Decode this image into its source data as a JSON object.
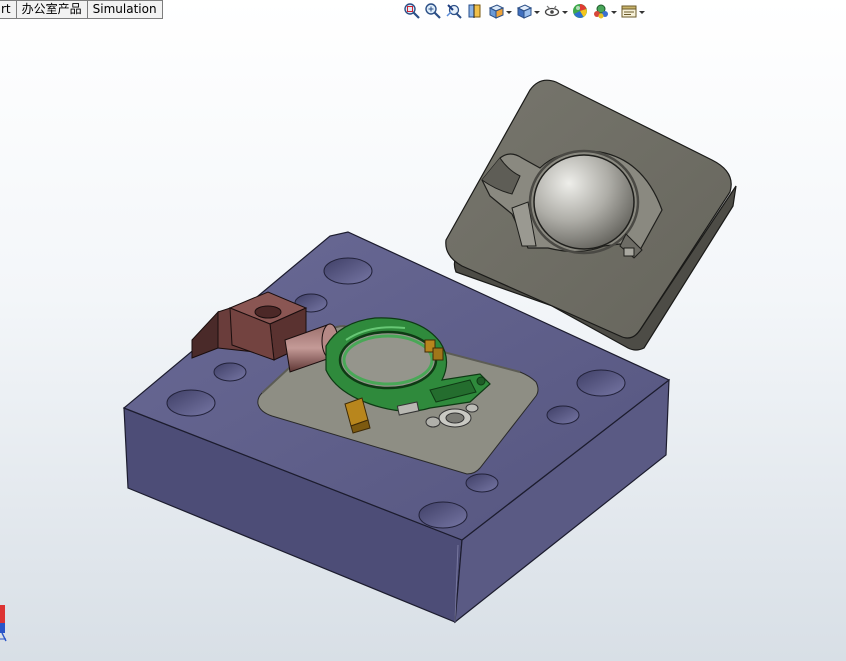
{
  "tabs": [
    {
      "label": "rt"
    },
    {
      "label": "办公室产品"
    },
    {
      "label": "Simulation"
    }
  ],
  "toolbar": {
    "buttons": [
      {
        "icon": "zoom-to-fit-icon",
        "dropdown": false
      },
      {
        "icon": "zoom-to-area-icon",
        "dropdown": false
      },
      {
        "icon": "previous-view-icon",
        "dropdown": false
      },
      {
        "icon": "section-view-icon",
        "dropdown": false
      },
      {
        "icon": "view-orientation-icon",
        "dropdown": true
      },
      {
        "icon": "display-style-icon",
        "dropdown": true
      },
      {
        "icon": "hide-show-items-icon",
        "dropdown": true
      },
      {
        "icon": "edit-appearance-icon",
        "dropdown": false
      },
      {
        "icon": "apply-scene-icon",
        "dropdown": true
      },
      {
        "icon": "view-settings-icon",
        "dropdown": true
      }
    ]
  },
  "model": {
    "colors": {
      "base_plate": "#5c5c88",
      "cavity_block": "#6b6a62",
      "pocket": "#8f8f85",
      "part": "#2f8a3c",
      "slider": "#6a3d3b",
      "insert": "#b8861d"
    }
  }
}
